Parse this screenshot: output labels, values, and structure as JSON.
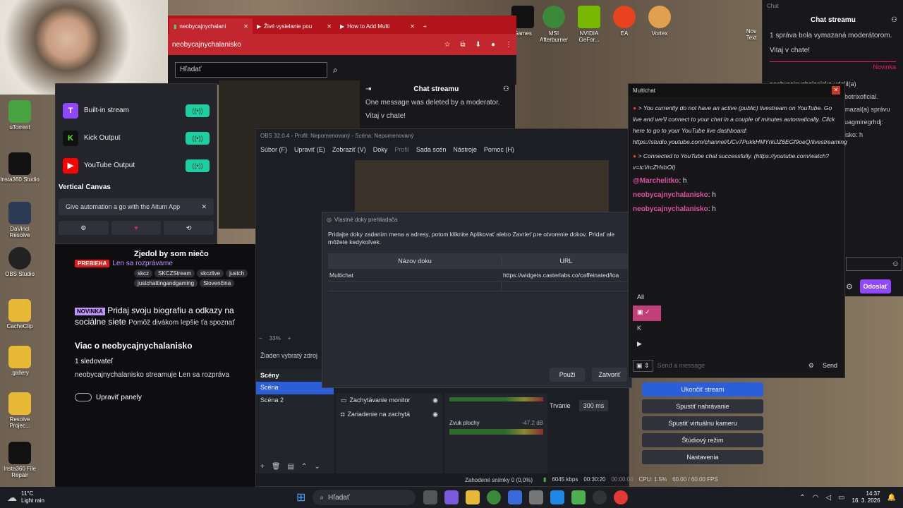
{
  "browser": {
    "tabs": [
      {
        "label": "neobycajnychalani"
      },
      {
        "label": "Živé vysielanie pou"
      },
      {
        "label": "How to Add Multi"
      }
    ],
    "url": "neobycajnychalanisko",
    "search_placeholder": "Hľadať",
    "chat_title": "Chat streamu",
    "chat_msg1": "One message was deleted by a moderator.",
    "chat_msg2": "Vitaj v chate!"
  },
  "desktop_top_icons": [
    {
      "label": "Games"
    },
    {
      "label": "MSI Afterburner"
    },
    {
      "label": "NVIDIA GeFor..."
    },
    {
      "label": "EA"
    },
    {
      "label": "Vortex"
    },
    {
      "label": "Nov Text"
    }
  ],
  "desktop_left_icons": [
    {
      "label": "uTorrent"
    },
    {
      "label": "Insta360 Studio"
    },
    {
      "label": "DaVinci Resolve"
    },
    {
      "label": "OBS Studio"
    },
    {
      "label": "CacheClip"
    },
    {
      "label": ".gallery"
    },
    {
      "label": "Resolve Projec..."
    },
    {
      "label": "Insta360 File Repair"
    }
  ],
  "aitum": {
    "outputs": [
      {
        "label": "Built-in stream",
        "color": "#9146ff",
        "glyph": "T"
      },
      {
        "label": "Kick Output",
        "color": "#53fc18",
        "glyph": "K"
      },
      {
        "label": "YouTube Output",
        "color": "#ff0000",
        "glyph": "▶"
      }
    ],
    "vertical_canvas": "Vertical Canvas",
    "promo": "Give automation a go with the Aitum App",
    "close": "✕"
  },
  "twitch_sidebar": {
    "stream_title": "Zjedol by som niečo",
    "badge": "PREBIEHA",
    "category": "Len sa rozprávame",
    "tags": [
      "skcz",
      "SKCZStream",
      "skczlive",
      "justch",
      "justchattingandgaming",
      "Slovenčina"
    ],
    "new_badge": "NOVINKA",
    "bio_promo": "Pridaj svoju biografiu a odkazy na sociálne siete",
    "bio_promo_sub": "Pomôž divákom lepšie ťa spoznať",
    "about_title": "Viac o neobycajnychalanisko",
    "followers": "1 sledovateľ",
    "desc": "neobycajnychalanisko streamuje Len sa rozpráva",
    "edit_panels": "Upraviť panely"
  },
  "obs": {
    "title": "OBS 32.0.4 - Profil: Nepomenovaný - Scéna: Nepomenovaný",
    "menu": [
      "Súbor (F)",
      "Upraviť (E)",
      "Zobraziť (V)",
      "Doky",
      "Profil",
      "Sada scén",
      "Nástroje",
      "Pomoc (H)"
    ],
    "zoom": "33%",
    "no_source": "Žiaden vybratý zdroj",
    "scenes_title": "Scény",
    "scenes": [
      "Scéna",
      "Scéna 2"
    ],
    "sources": [
      "Zachytávanie monitor",
      "Zariadenie na zachytá"
    ],
    "audio_label": "Zvuk plochy",
    "audio_db": "-47.2 dB",
    "transition_label": "Trvanie",
    "transition_value": "300 ms",
    "controls": [
      "Ukončiť stream",
      "Spustiť nahrávanie",
      "Spustiť virtuálnu kameru",
      "Štúdiový režim",
      "Nastavenia"
    ],
    "status": {
      "dropped": "Zahodené snímky 0 (0,0%)",
      "kbps": "6045 kbps",
      "live_time": "00:30:20",
      "rec_time": "00:00:00",
      "cpu": "CPU: 1.5%",
      "fps": "60.00 / 60.00 FPS"
    }
  },
  "dialog": {
    "title": "Vlastné doky prehliadača",
    "desc": "Pridajte doky zadaním mena a adresy, potom kliknite Aplikovať alebo Zavrieť pre otvorenie dokov. Pridať ale môžete kedykoľvek.",
    "col_name": "Názov doku",
    "col_url": "URL",
    "row_name": "Multichat",
    "row_url": "https://widgets.casterlabs.co/caffeinated/loa",
    "apply": "Použi",
    "close": "Zatvoriť"
  },
  "multichat": {
    "title": "Multichat",
    "msg1": "> You currently do not have an active (public) livestream on YouTube. Go live and we'll connect to your chat in a couple of minutes automatically. Click here to go to your YouTube live dashboard: https://studio.youtube.com/channel/UCv7PukkHMYrkiJZ6EGf9oeQ/livestreaming",
    "msg2": "> Connected to YouTube chat successfully. (https://youtube.com/watch?v=tcVrcZHsbOI)",
    "chat_lines": [
      {
        "user": "@Marchelitko",
        "text": "h"
      },
      {
        "user": "neobycajnychalanisko",
        "text": "h"
      },
      {
        "user": "neobycajnychalanisko",
        "text": "h"
      }
    ],
    "filter_all": "All",
    "input_placeholder": "Send a message",
    "send": "Send"
  },
  "twitch_chat": {
    "small_title": "Chat",
    "title": "Chat streamu",
    "msg1": "1 správa bola vymazaná moderátorom.",
    "msg2": "Vitaj v chate!",
    "novinka": "Novinka",
    "partial_lines": [
      "neobycajnychalanisko udelil(a)",
      "botrixoficial.",
      "mazal(a) správu",
      "uagmiregrhdj:",
      "isko: h"
    ],
    "send_button": "Odoslať"
  },
  "taskbar": {
    "weather_temp": "11°C",
    "weather_desc": "Light rain",
    "search": "Hľadať",
    "time": "14:37",
    "date": "16. 3. 2026"
  }
}
